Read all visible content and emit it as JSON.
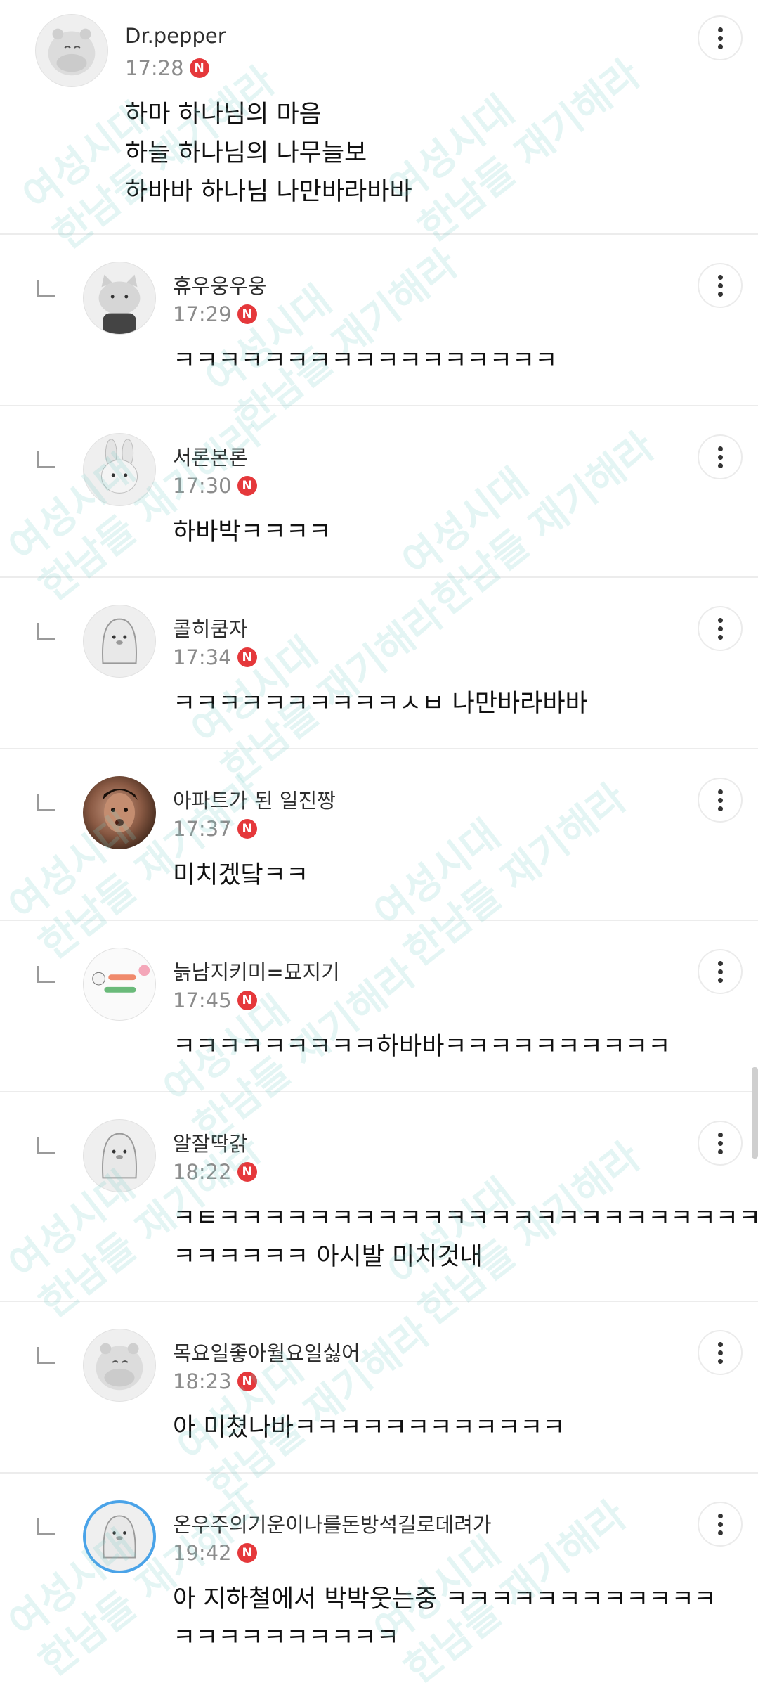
{
  "comments": [
    {
      "name": "Dr.pepper",
      "time": "17:28",
      "badge": "N",
      "lines": [
        "하마 하나님의 마음",
        "하늘 하나님의 나무늘보",
        "하바바 하나님 나만바라바바"
      ]
    },
    {
      "name": "휴우웅우웅",
      "time": "17:29",
      "badge": "N",
      "lines": [
        "ㅋㅋㅋㅋㅋㅋㅋㅋㅋㅋㅋㅋㅋㅋㅋㅋㅋ"
      ]
    },
    {
      "name": "서론본론",
      "time": "17:30",
      "badge": "N",
      "lines": [
        "하바박ㅋㅋㅋㅋ"
      ]
    },
    {
      "name": "콜히쿰자",
      "time": "17:34",
      "badge": "N",
      "lines": [
        "ㅋㅋㅋㅋㅋㅋㅋㅋㅋㅋㅅㅂ 나만바라바바"
      ]
    },
    {
      "name": "아파트가 된 일진짱",
      "time": "17:37",
      "badge": "N",
      "lines": [
        "미치겠닼ㅋㅋ"
      ]
    },
    {
      "name": "늙남지키미=묘지기",
      "time": "17:45",
      "badge": "N",
      "lines": [
        "ㅋㅋㅋㅋㅋㅋㅋㅋㅋ하바바ㅋㅋㅋㅋㅋㅋㅋㅋㅋㅋ"
      ]
    },
    {
      "name": "알잘딱갉",
      "time": "18:22",
      "badge": "N",
      "lines": [
        "ㅋㅌㅋㅋㅋㅋㅋㅋㅋㅋㅋㅋㅋㅋㅋㅋㅋㅋㅋㅋㅋㅋㅋㅋㅋㅋ",
        "ㅋㅋㅋㅋㅋㅋ 아시발 미치것내"
      ]
    },
    {
      "name": "목요일좋아월요일싫어",
      "time": "18:23",
      "badge": "N",
      "lines": [
        "아 미쳤나바ㅋㅋㅋㅋㅋㅋㅋㅋㅋㅋㅋㅋ"
      ]
    },
    {
      "name": "온우주의기운이나를돈방석길로데려가",
      "time": "19:42",
      "badge": "N",
      "lines": [
        "아 지하철에서 박박웃는중 ㅋㅋㅋㅋㅋㅋㅋㅋㅋㅋㅋㅋ",
        "ㅋㅋㅋㅋㅋㅋㅋㅋㅋㅋ"
      ]
    }
  ],
  "watermark": {
    "line1": "여성시대",
    "line2": "한남들 재기해라"
  },
  "icons": {
    "more": "more-vertical-icon",
    "reply": "reply-arrow-icon"
  },
  "colors": {
    "badge": "#e5383b",
    "watermark": "#78cdc8",
    "story_ring": "#4aa3e8"
  }
}
